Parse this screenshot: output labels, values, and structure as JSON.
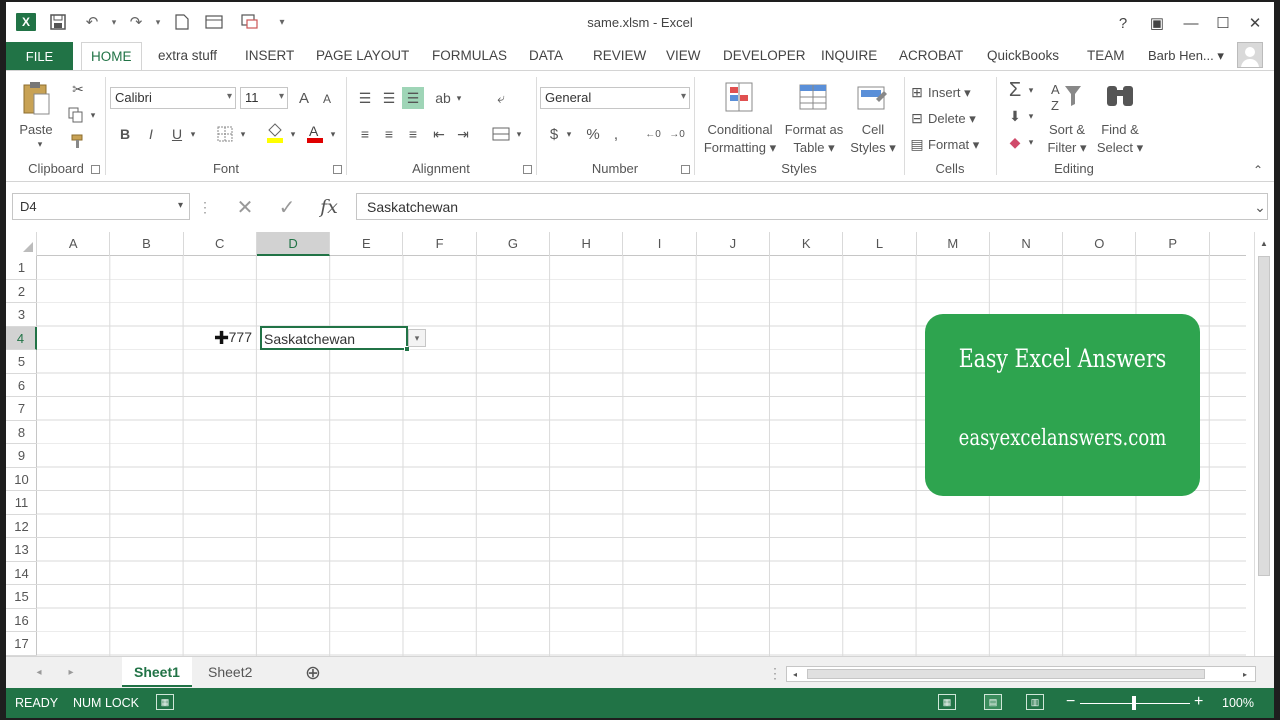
{
  "window": {
    "title": "same.xlsm - Excel"
  },
  "titlebar": {
    "app_icon": "excel-icon",
    "qat": [
      "save-icon",
      "undo-icon",
      "redo-icon",
      "new-file-icon",
      "print-preview-icon",
      "customize-icon"
    ],
    "controls": {
      "help": "?",
      "restore_ribbon": "▣",
      "minimize": "—",
      "maximize": "☐",
      "close": "✕"
    }
  },
  "tabs": {
    "file": "FILE",
    "items": [
      "HOME",
      "extra stuff",
      "INSERT",
      "PAGE LAYOUT",
      "FORMULAS",
      "DATA",
      "REVIEW",
      "VIEW",
      "DEVELOPER",
      "INQUIRE",
      "ACROBAT",
      "QuickBooks",
      "TEAM"
    ],
    "active": "HOME",
    "user": "Barb Hen... ▾"
  },
  "ribbon": {
    "clipboard": {
      "label": "Clipboard",
      "paste": "Paste"
    },
    "font": {
      "label": "Font",
      "font_name": "Calibri",
      "font_size": "11",
      "bold": "B",
      "italic": "I",
      "underline": "U",
      "grow": "A",
      "shrink": "A"
    },
    "alignment": {
      "label": "Alignment"
    },
    "number": {
      "label": "Number",
      "format": "General",
      "currency": "$",
      "percent": "%",
      "comma": ","
    },
    "styles": {
      "label": "Styles",
      "conditional_1": "Conditional",
      "conditional_2": "Formatting ▾",
      "format_table_1": "Format as",
      "format_table_2": "Table ▾",
      "cell_styles_1": "Cell",
      "cell_styles_2": "Styles ▾"
    },
    "cells": {
      "label": "Cells",
      "insert": "Insert ▾",
      "delete": "Delete ▾",
      "format": "Format ▾"
    },
    "editing": {
      "label": "Editing",
      "sort_1": "Sort &",
      "sort_2": "Filter ▾",
      "find_1": "Find &",
      "find_2": "Select ▾"
    },
    "accent": "#217346"
  },
  "formula_bar": {
    "name_box": "D4",
    "cancel": "✕",
    "enter": "✓",
    "fx": "fx",
    "value": "Saskatchewan"
  },
  "grid": {
    "columns": [
      "A",
      "B",
      "C",
      "D",
      "E",
      "F",
      "G",
      "H",
      "I",
      "J",
      "K",
      "L",
      "M",
      "N",
      "O",
      "P"
    ],
    "rows": [
      "1",
      "2",
      "3",
      "4",
      "5",
      "6",
      "7",
      "8",
      "9",
      "10",
      "11",
      "12",
      "13",
      "14",
      "15",
      "16",
      "17"
    ],
    "selected_column": "D",
    "selected_row": "4",
    "cells": {
      "C4": "777",
      "D4": "Saskatchewan"
    }
  },
  "promo": {
    "title": "Easy Excel Answers",
    "url": "easyexcelanswers.com",
    "color": "#2ea44f"
  },
  "sheets": {
    "tabs": [
      "Sheet1",
      "Sheet2"
    ],
    "active": "Sheet1",
    "add": "⊕"
  },
  "status": {
    "ready": "READY",
    "numlock": "NUM LOCK",
    "zoom": "100%",
    "minus": "−",
    "plus": "+"
  }
}
